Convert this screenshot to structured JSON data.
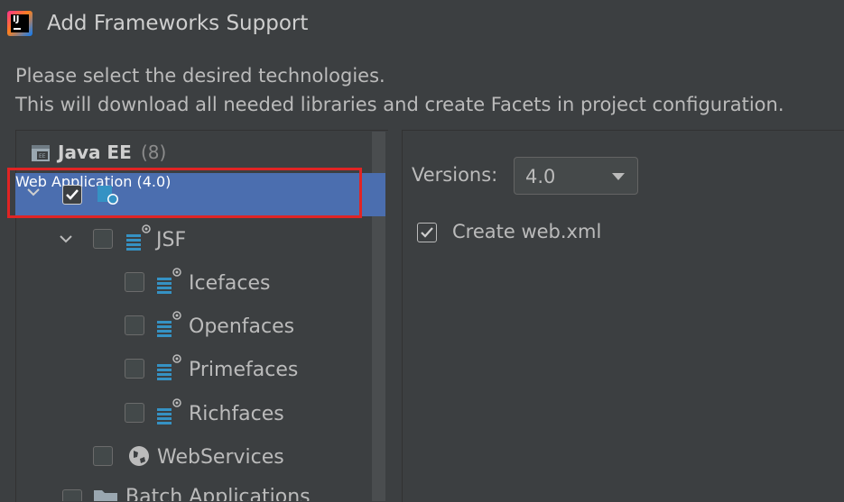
{
  "title": "Add Frameworks Support",
  "description": {
    "line1": "Please select the desired technologies.",
    "line2": "This will download all needed libraries and create Facets in project configuration."
  },
  "tree": {
    "group_label": "Java EE",
    "group_count": "(8)",
    "items": [
      {
        "label": "Web Application (4.0)",
        "checked": true,
        "icon": "web-module-icon"
      },
      {
        "label": "JSF",
        "checked": false,
        "icon": "jsf-icon"
      },
      {
        "label": "Icefaces",
        "checked": false,
        "icon": "jsf-icon"
      },
      {
        "label": "Openfaces",
        "checked": false,
        "icon": "jsf-icon"
      },
      {
        "label": "Primefaces",
        "checked": false,
        "icon": "jsf-icon"
      },
      {
        "label": "Richfaces",
        "checked": false,
        "icon": "jsf-icon"
      },
      {
        "label": "WebServices",
        "checked": false,
        "icon": "globe-icon"
      },
      {
        "label": "Batch Applications",
        "checked": false,
        "icon": "folder-icon"
      }
    ]
  },
  "settings": {
    "versions_label": "Versions:",
    "version_value": "4.0",
    "create_web_xml_label": "Create web.xml",
    "create_web_xml_checked": true
  },
  "colors": {
    "background": "#3c3f41",
    "selection": "#4b6eaf",
    "highlight_border": "#e02424",
    "icon_blue": "#3592c4"
  }
}
